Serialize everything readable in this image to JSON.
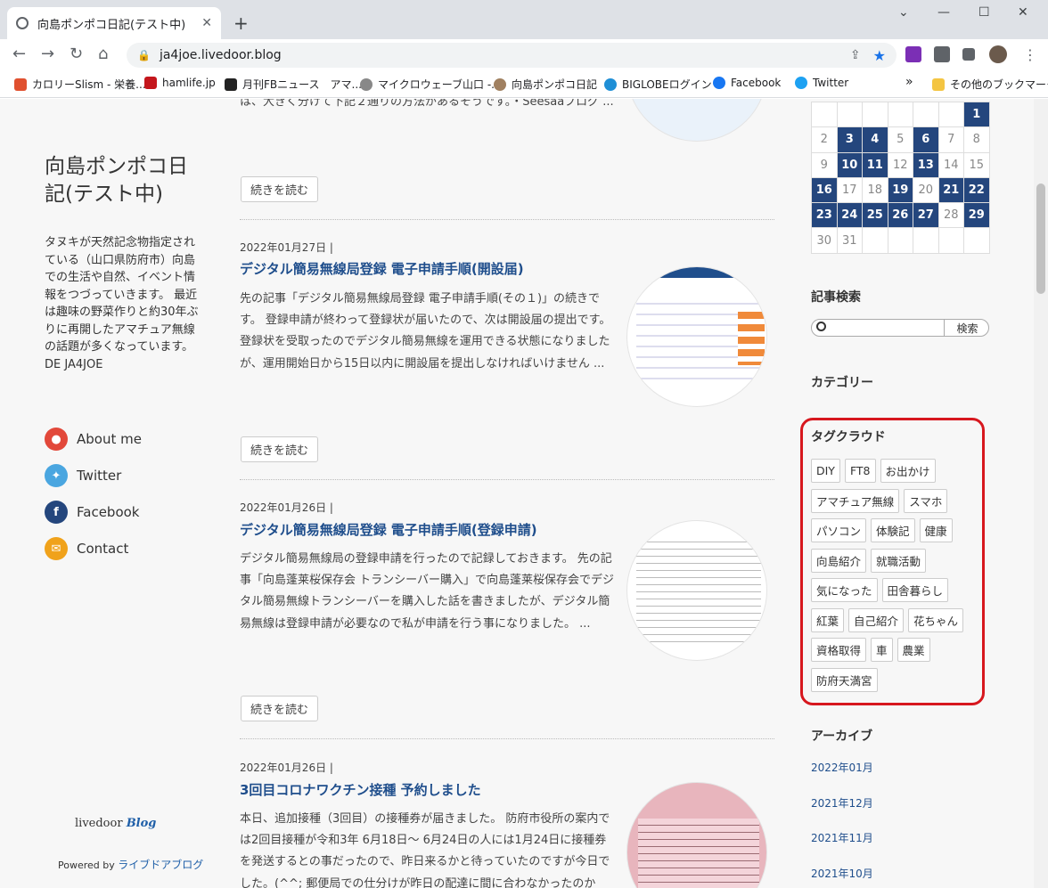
{
  "browser": {
    "tab_title": "向島ポンポコ日記(テスト中)",
    "url": "ja4joe.livedoor.blog",
    "bookmarks": [
      "カロリーSlism - 栄養...",
      "hamlife.jp",
      "月刊FBニュース　アマ...",
      "マイクロウェーブ山口 -...",
      "向島ポンポコ日記",
      "BIGLOBEログイン",
      "Facebook",
      "Twitter",
      "その他のブックマーク"
    ],
    "bookmark_more": "»"
  },
  "site": {
    "title": "向島ポンポコ日記(テスト中)",
    "description": "タヌキが天然記念物指定されている（山口県防府市）向島での生活や自然、イベント情報をつづっていきます。 最近は趣味の野菜作りと約30年ぶりに再開したアマチュア無線の話題が多くなっています。DE JA4JOE",
    "social": [
      {
        "label": "About me",
        "color": "#e2483a",
        "glyph": "person-icon"
      },
      {
        "label": "Twitter",
        "color": "#4aa6e0",
        "glyph": "twitter-icon"
      },
      {
        "label": "Facebook",
        "color": "#24467d",
        "glyph": "facebook-icon"
      },
      {
        "label": "Contact",
        "color": "#f0a21b",
        "glyph": "mail-icon"
      }
    ],
    "powered_label": "Powered by",
    "powered_link": "ライブドアブログ",
    "logo_text": "livedoor",
    "logo_blog": "Blog"
  },
  "posts": {
    "top_excerpt": "は、大きく分けて下記２通りの方法があるそうです。・Seesaaブログ ...",
    "read_more": "続きを読む",
    "items": [
      {
        "date": "2022年01月27日 |",
        "title": "デジタル簡易無線局登録 電子申請手順(開設届)",
        "body": "先の記事「デジタル簡易無線局登録 電子申請手順(その１)」の続きです。 登録申請が終わって登録状が届いたので、次は開設届の提出です。 登録状を受取ったのでデジタル簡易無線を運用できる状態になりましたが、運用開始日から15日以内に開設届を提出しなければいけません ..."
      },
      {
        "date": "2022年01月26日 |",
        "title": "デジタル簡易無線局登録 電子申請手順(登録申請)",
        "body": "デジタル簡易無線局の登録申請を行ったので記録しておきます。 先の記事「向島蓬莱桜保存会 トランシーバー購入」で向島蓬莱桜保存会でデジタル簡易無線トランシーバーを購入した話を書きましたが、デジタル簡易無線は登録申請が必要なので私が申請を行う事になりました。 ..."
      },
      {
        "date": "2022年01月26日 |",
        "title": "3回目コロナワクチン接種 予約しました",
        "body": "本日、追加接種（3回目）の接種券が届きました。 防府市役所の案内では2回目接種が令和3年 6月18日～ 6月24日の人には1月24日に接種券を発送するとの事だったので、昨日来るかと待っていたのですが今日でした。(^^; 郵便局での仕分けが昨日の配達に間に合わなかったのか"
      }
    ]
  },
  "calendar": {
    "rows": [
      [
        "",
        "",
        "",
        "",
        "",
        "",
        "1"
      ],
      [
        "2",
        "3",
        "4",
        "5",
        "6",
        "7",
        "8"
      ],
      [
        "9",
        "10",
        "11",
        "12",
        "13",
        "14",
        "15"
      ],
      [
        "16",
        "17",
        "18",
        "19",
        "20",
        "21",
        "22"
      ],
      [
        "23",
        "24",
        "25",
        "26",
        "27",
        "28",
        "29"
      ],
      [
        "30",
        "31",
        "",
        "",
        "",
        "",
        ""
      ]
    ],
    "highlighted": [
      "1",
      "3",
      "4",
      "6",
      "10",
      "11",
      "13",
      "16",
      "19",
      "21",
      "22",
      "23",
      "24",
      "25",
      "26",
      "27",
      "29"
    ]
  },
  "sidebar": {
    "search_heading": "記事検索",
    "search_button": "検索",
    "category_heading": "カテゴリー",
    "tag_heading": "タグクラウド",
    "tags": [
      "DIY",
      "FT8",
      "お出かけ",
      "アマチュア無線",
      "スマホ",
      "パソコン",
      "体験記",
      "健康",
      "向島紹介",
      "就職活動",
      "気になった",
      "田舎暮らし",
      "紅葉",
      "自己紹介",
      "花ちゃん",
      "資格取得",
      "車",
      "農業",
      "防府天満宮"
    ],
    "archive_heading": "アーカイブ",
    "archives": [
      "2022年01月",
      "2021年12月",
      "2021年11月",
      "2021年10月"
    ]
  }
}
